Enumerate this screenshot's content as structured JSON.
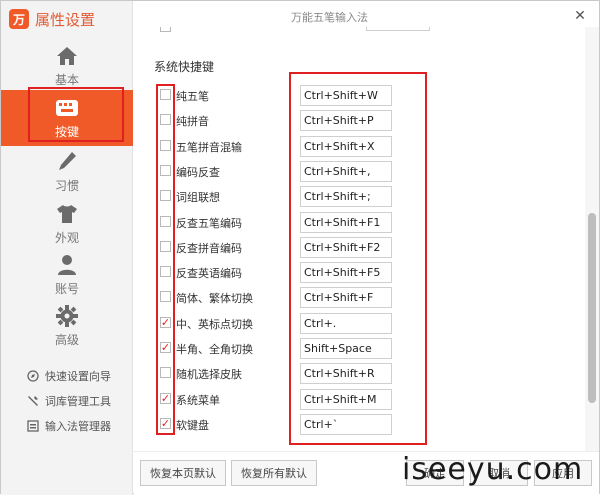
{
  "app": {
    "title": "属性设置",
    "logo_text": "万",
    "window_title": "万能五笔输入法"
  },
  "sidebar": {
    "nav": [
      {
        "label": "基本",
        "icon": "home-icon"
      },
      {
        "label": "按键",
        "icon": "keyboard-icon",
        "active": true
      },
      {
        "label": "习惯",
        "icon": "pen-icon"
      },
      {
        "label": "外观",
        "icon": "shirt-icon"
      },
      {
        "label": "账号",
        "icon": "user-icon"
      },
      {
        "label": "高级",
        "icon": "gear-icon"
      }
    ],
    "tools": [
      {
        "label": "快速设置向导",
        "icon": "compass-icon"
      },
      {
        "label": "词库管理工具",
        "icon": "wrench-icon"
      },
      {
        "label": "输入法管理器",
        "icon": "manager-icon"
      }
    ]
  },
  "content": {
    "section_title": "系统快捷键",
    "shortcuts": [
      {
        "label": "纯五笔",
        "key": "Ctrl+Shift+W",
        "checked": false
      },
      {
        "label": "纯拼音",
        "key": "Ctrl+Shift+P",
        "checked": false
      },
      {
        "label": "五笔拼音混输",
        "key": "Ctrl+Shift+X",
        "checked": false
      },
      {
        "label": "编码反查",
        "key": "Ctrl+Shift+,",
        "checked": false
      },
      {
        "label": "词组联想",
        "key": "Ctrl+Shift+;",
        "checked": false
      },
      {
        "label": "反查五笔编码",
        "key": "Ctrl+Shift+F1",
        "checked": false
      },
      {
        "label": "反查拼音编码",
        "key": "Ctrl+Shift+F2",
        "checked": false
      },
      {
        "label": "反查英语编码",
        "key": "Ctrl+Shift+F5",
        "checked": false
      },
      {
        "label": "简体、繁体切换",
        "key": "Ctrl+Shift+F",
        "checked": false
      },
      {
        "label": "中、英标点切换",
        "key": "Ctrl+.",
        "checked": true
      },
      {
        "label": "半角、全角切换",
        "key": "Shift+Space",
        "checked": true
      },
      {
        "label": "随机选择皮肤",
        "key": "Ctrl+Shift+R",
        "checked": false
      },
      {
        "label": "系统菜单",
        "key": "Ctrl+Shift+M",
        "checked": true
      },
      {
        "label": "软键盘",
        "key": "Ctrl+`",
        "checked": true
      }
    ]
  },
  "footer": {
    "restore_page": "恢复本页默认",
    "restore_all": "恢复所有默认",
    "ok": "确定",
    "cancel": "取消",
    "apply": "应用",
    "watermark": "iseeyu.com"
  },
  "colors": {
    "accent": "#f05a28",
    "highlight": "#e02020"
  }
}
